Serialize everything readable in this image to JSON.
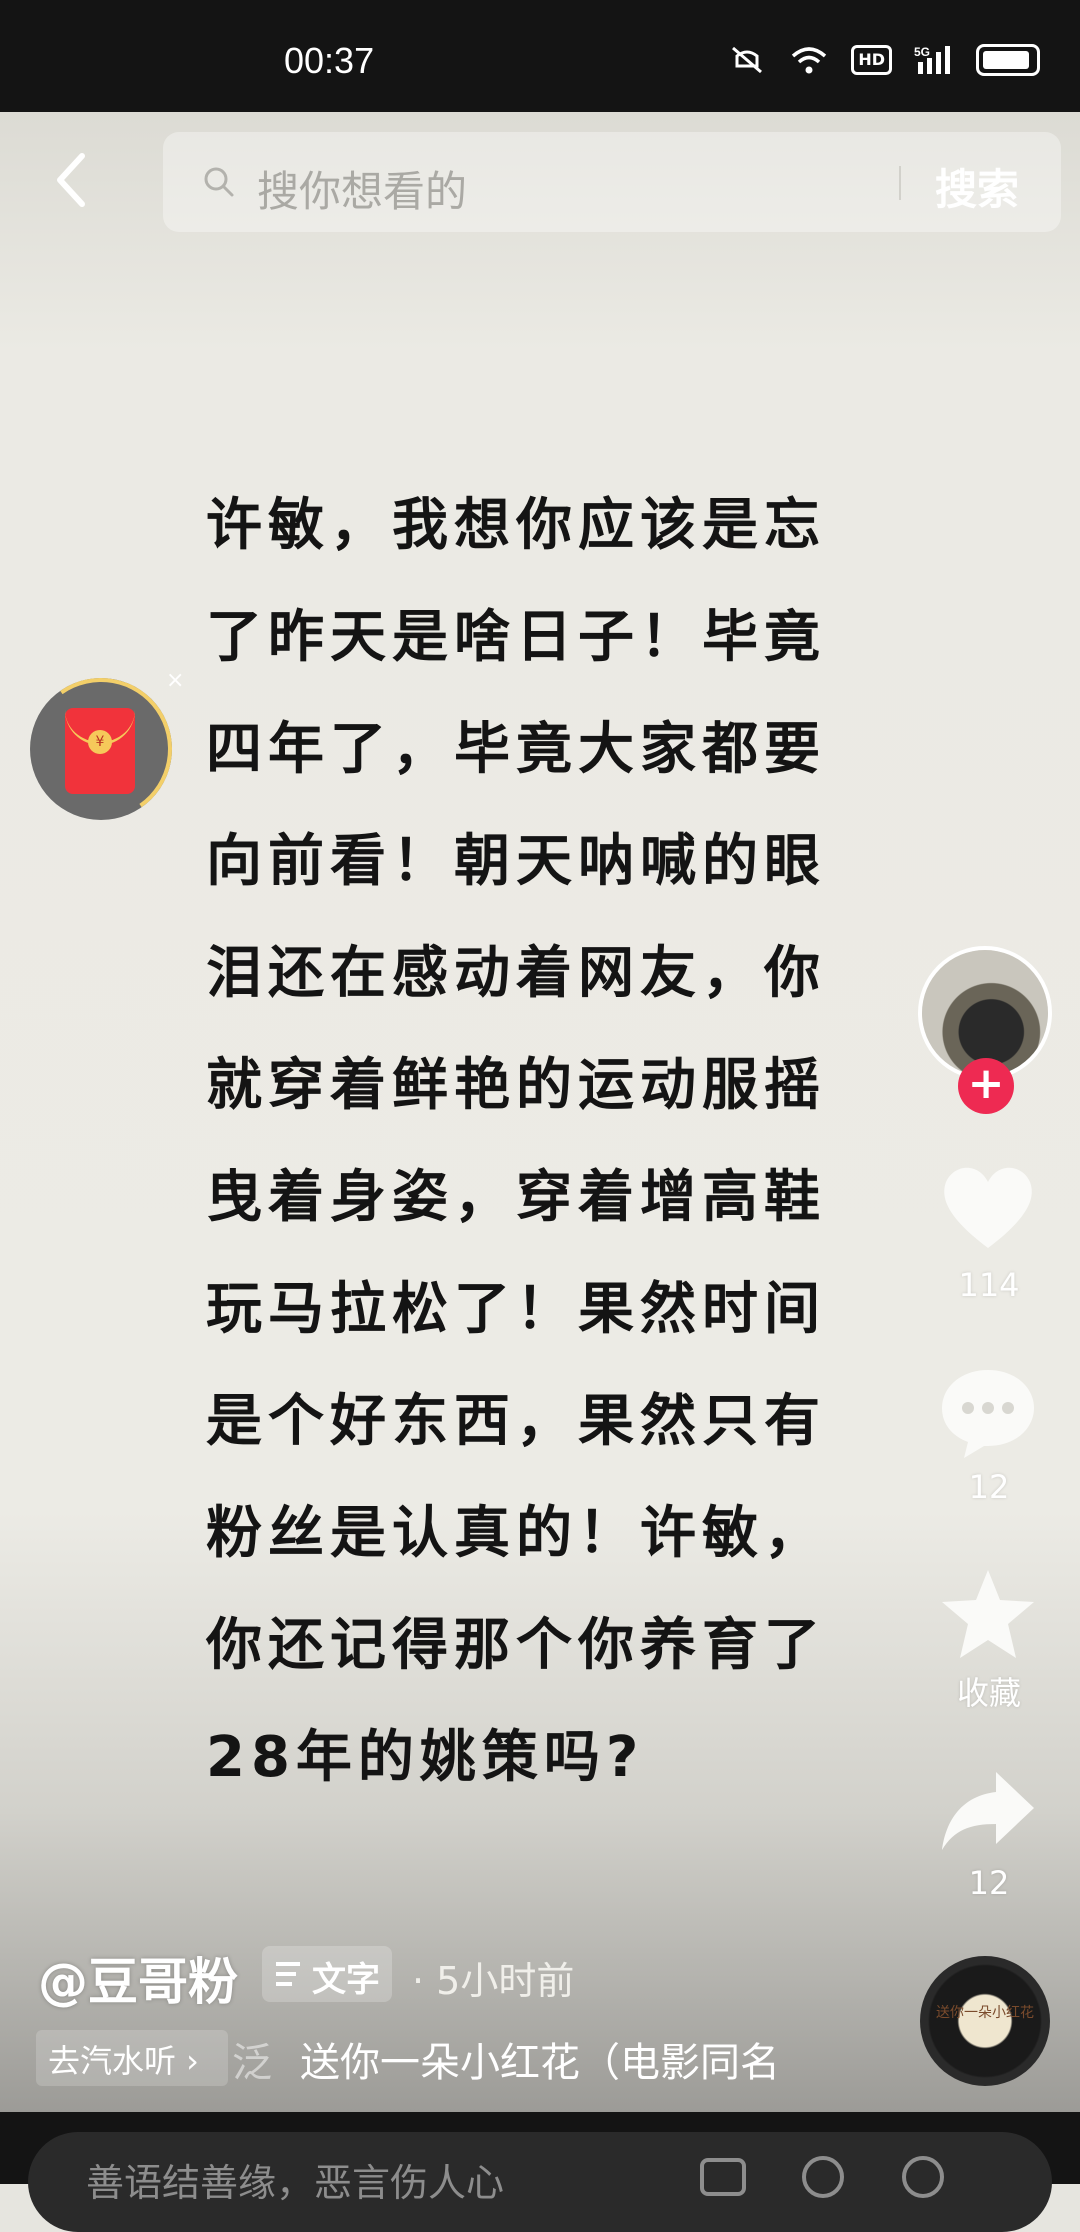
{
  "status_bar": {
    "time": "00:37",
    "icons": [
      "mute-icon",
      "wifi-icon",
      "hd-icon",
      "signal-5g-icon",
      "battery-icon"
    ],
    "hd_label": "HD",
    "network_label": "5G"
  },
  "search": {
    "placeholder": "搜你想看的",
    "button_label": "搜索"
  },
  "post": {
    "text_lines": [
      "许敏，我想你应该是忘",
      "了昨天是啥日子！毕竟",
      "四年了，毕竟大家都要",
      "向前看！朝天呐喊的眼",
      "泪还在感动着网友，你",
      "就穿着鲜艳的运动服摇",
      "曳着身姿，穿着增高鞋",
      "玩马拉松了！果然时间",
      "是个好东西，果然只有",
      "粉丝是认真的！许敏，",
      "你还记得那个你养育了",
      "28年的姚策吗?"
    ],
    "author": "@豆哥粉",
    "tag_label": "文字",
    "time_ago": "· 5小时前"
  },
  "red_packet": {
    "coin": "¥",
    "close": "×"
  },
  "rail": {
    "follow": "+",
    "like_count": "114",
    "comment_count": "12",
    "favorite_label": "收藏",
    "share_count": "12"
  },
  "music": {
    "button_label": "去汽水听 ›",
    "clipped_prefix": "泛",
    "title": "送你一朵小红花（电影同名",
    "disc_label": "送你一朵小红花"
  },
  "comment_bar": {
    "placeholder": "善语结善缘，恶言伤人心"
  },
  "colors": {
    "status_bar": "#141414",
    "accent_red": "#ee2a52",
    "background": "#e6e5df",
    "text": "#141414"
  }
}
